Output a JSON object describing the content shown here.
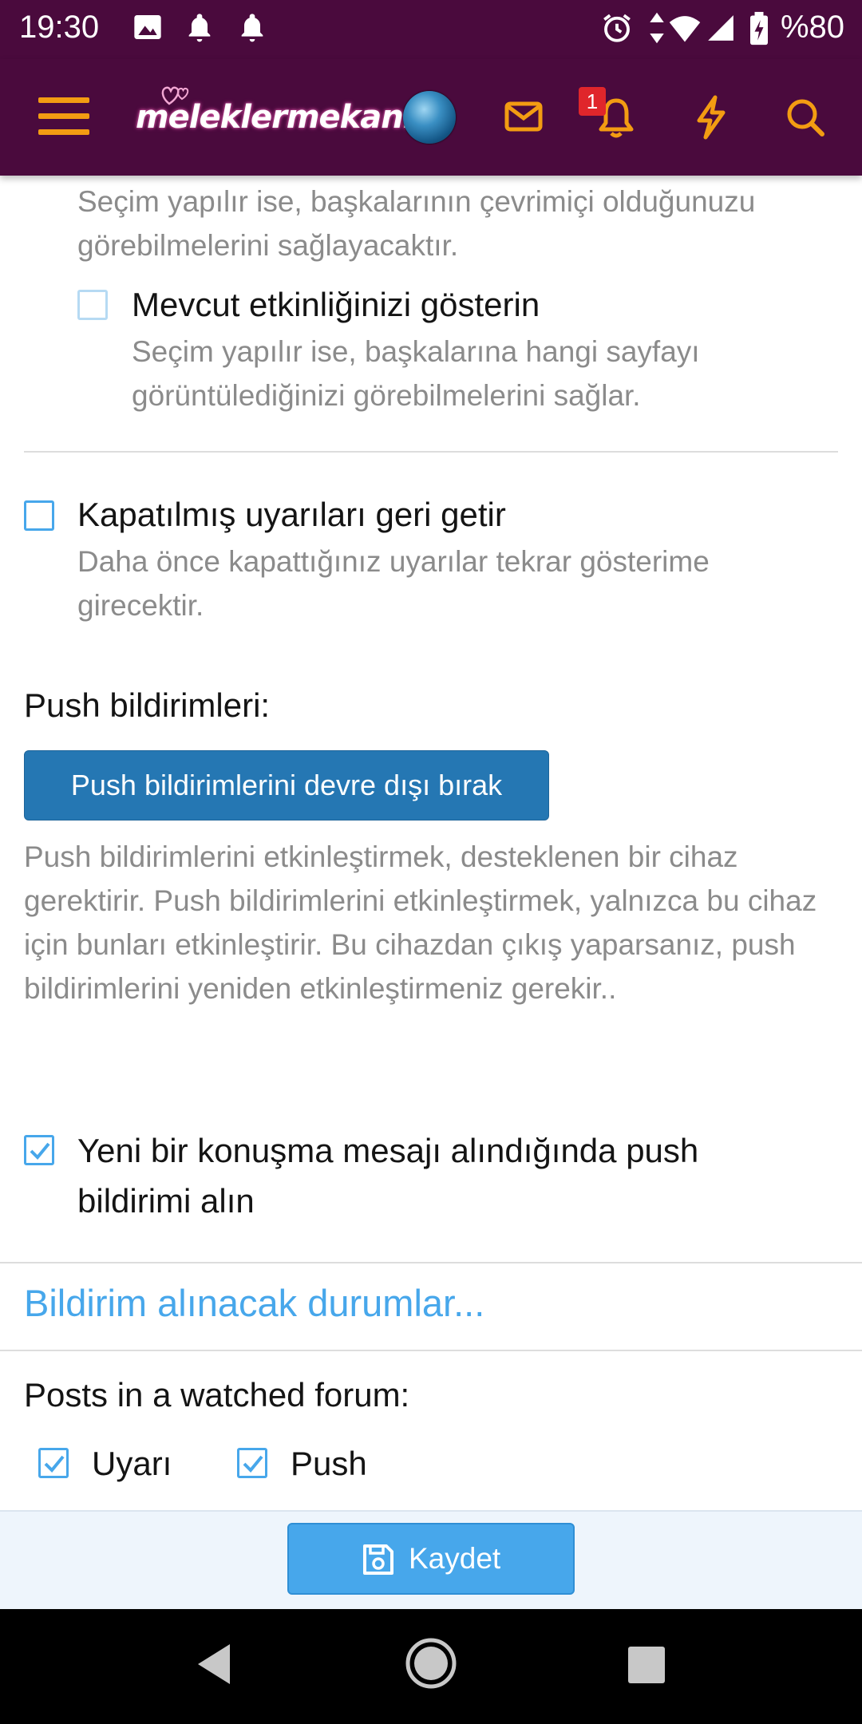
{
  "status_bar": {
    "time": "19:30",
    "battery": "%80",
    "icons": [
      "image-icon",
      "bell-icon",
      "bell-icon",
      "alarm-icon",
      "data-arrows-icon",
      "wifi-icon",
      "signal-icon",
      "battery-charging-icon"
    ]
  },
  "header": {
    "logo_text": "meleklermekanı",
    "notification_count": "1",
    "accent": "#f39c12",
    "background": "#4a0a3d"
  },
  "settings": {
    "online_desc": "Seçim yapılır ise, başkalarının çevrimiçi olduğunuzu görebilmelerini sağlayacaktır.",
    "activity_label": "Mevcut etkinliğinizi gösterin",
    "activity_desc": "Seçim yapılır ise, başkalarına hangi sayfayı görüntülediğinizi görebilmelerini sağlar.",
    "activity_checked": false,
    "restore_label": "Kapatılmış uyarıları geri getir",
    "restore_desc": "Daha önce kapattığınız uyarılar tekrar gösterime girecektir.",
    "restore_checked": false,
    "push_heading": "Push bildirimleri:",
    "push_button": "Push bildirimlerini devre dışı bırak",
    "push_desc": "Push bildirimlerini etkinleştirmek, desteklenen bir cihaz gerektirir. Push bildirimlerini etkinleştirmek, yalnızca bu cihaz için bunları etkinleştirir. Bu cihazdan çıkış yaparsanız, push bildirimlerini yeniden etkinleştirmeniz gerekir..",
    "conversation_label": "Yeni bir konuşma mesajı alındığında push bildirimi alın",
    "conversation_checked": true
  },
  "alerts_section": {
    "title": "Bildirim alınacak durumlar...",
    "row_label": "Posts in a watched forum:",
    "alert_option": "Uyarı",
    "alert_checked": true,
    "push_option": "Push",
    "push_checked": true
  },
  "footer": {
    "save_label": "Kaydet",
    "accent": "#47a7eb"
  }
}
